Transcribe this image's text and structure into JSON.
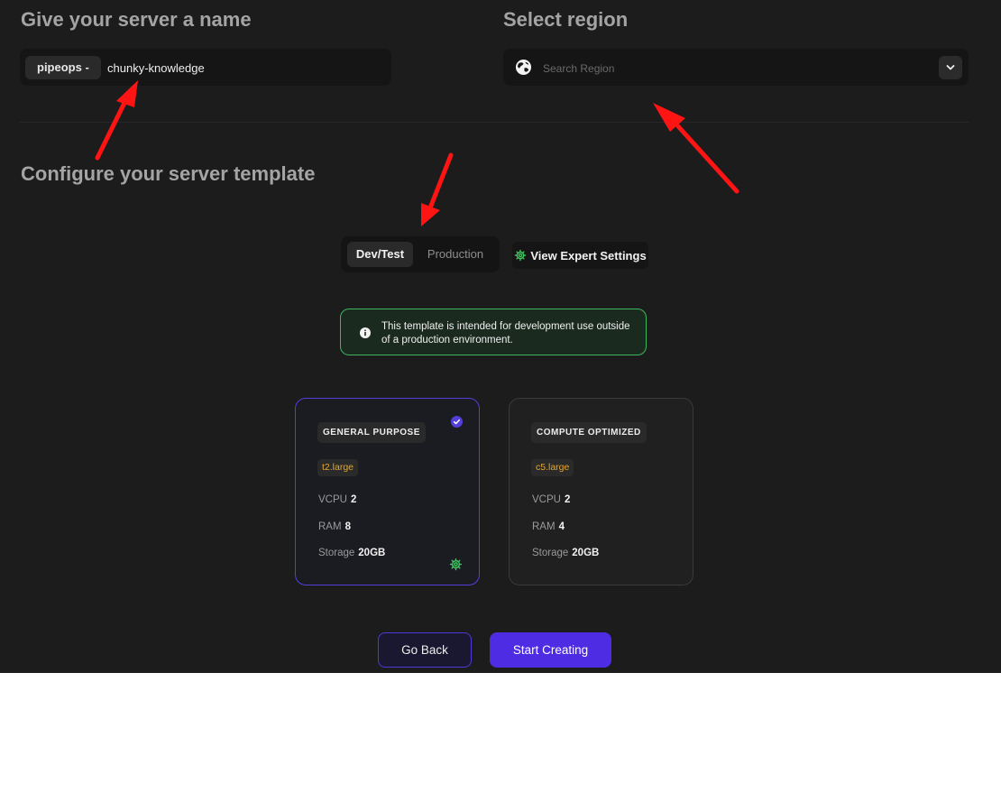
{
  "server_name": {
    "title": "Give your server a name",
    "prefix": "pipeops -",
    "value": "chunky-knowledge"
  },
  "region": {
    "title": "Select region",
    "placeholder": "Search Region",
    "globe_icon": "globe-icon",
    "dropdown_icon": "chevron-down-icon"
  },
  "template": {
    "title": "Configure your server template",
    "tabs": [
      {
        "label": "Dev/Test",
        "active": true
      },
      {
        "label": "Production",
        "active": false
      }
    ],
    "expert_settings_label": "View Expert Settings",
    "expert_settings_icon": "gear-icon",
    "notice": "This template is intended for development use outside of a production environment."
  },
  "cards": [
    {
      "badge": "GENERAL PURPOSE",
      "instance": "t2.large",
      "specs": [
        {
          "label": "VCPU",
          "value": "2"
        },
        {
          "label": "RAM",
          "value": "8"
        },
        {
          "label": "Storage",
          "value": "20GB"
        }
      ],
      "selected": true
    },
    {
      "badge": "COMPUTE OPTIMIZED",
      "instance": "c5.large",
      "specs": [
        {
          "label": "VCPU",
          "value": "2"
        },
        {
          "label": "RAM",
          "value": "4"
        },
        {
          "label": "Storage",
          "value": "20GB"
        }
      ],
      "selected": false
    }
  ],
  "actions": {
    "back_label": "Go Back",
    "start_label": "Start Creating"
  },
  "colors": {
    "accent": "#4d2ce4",
    "selected_border": "#5240d8",
    "instance_text": "#e4a52c",
    "notice_border": "#3eb55f",
    "annotation_arrow": "#ff1414"
  }
}
